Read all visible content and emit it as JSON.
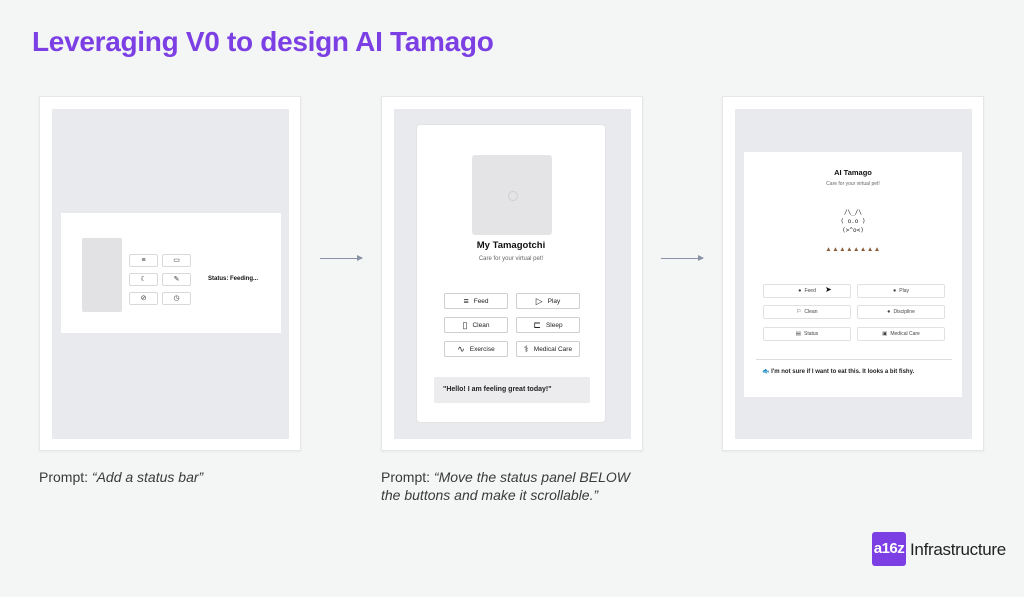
{
  "slide": {
    "title": "Leveraging V0 to design AI Tamago",
    "logo_mark": "a16z",
    "logo_text": "Infrastructure",
    "accent_color": "#7b3fe4"
  },
  "captions": [
    {
      "prefix": "Prompt: ",
      "quote": "“Add a status bar”"
    },
    {
      "prefix": "Prompt: ",
      "quote": "“Move the status panel BELOW the buttons and make it scrollable.”"
    }
  ],
  "panel1": {
    "buttons": [
      {
        "icon": "menu-icon",
        "glyph": "≡"
      },
      {
        "icon": "battery-icon",
        "glyph": "▭"
      },
      {
        "icon": "moon-icon",
        "glyph": "☾"
      },
      {
        "icon": "pencil-icon",
        "glyph": "✎"
      },
      {
        "icon": "pill-icon",
        "glyph": "⊘"
      },
      {
        "icon": "clock-icon",
        "glyph": "◷"
      }
    ],
    "status": "Status: Feeding..."
  },
  "panel2": {
    "pet_name": "My Tamagotchi",
    "subtitle": "Care for your virtual pet!",
    "buttons": [
      {
        "label": "Feed",
        "icon": "menu-icon",
        "glyph": "≡"
      },
      {
        "label": "Play",
        "icon": "play-icon",
        "glyph": "▷"
      },
      {
        "label": "Clean",
        "icon": "trash-icon",
        "glyph": "▯"
      },
      {
        "label": "Sleep",
        "icon": "bed-icon",
        "glyph": "⊏"
      },
      {
        "label": "Exercise",
        "icon": "activity-icon",
        "glyph": "∿"
      },
      {
        "label": "Medical Care",
        "icon": "medical-icon",
        "glyph": "⚕"
      }
    ],
    "status_message": "\"Hello! I am feeling great today!\""
  },
  "panel3": {
    "app_title": "AI Tamago",
    "subtitle": "Care for your virtual pet!",
    "ascii_art": "/\\_/\\\n( o.o )\n(>^o<)",
    "hearts": "▲▲▲▲▲▲▲▲",
    "buttons": [
      {
        "label": "Feed",
        "icon": "food-icon",
        "glyph": "●"
      },
      {
        "label": "Play",
        "icon": "play-icon",
        "glyph": "●"
      },
      {
        "label": "Clean",
        "icon": "clean-icon",
        "glyph": "⚐"
      },
      {
        "label": "Discipline",
        "icon": "discipline-icon",
        "glyph": "●"
      },
      {
        "label": "Status",
        "icon": "chart-icon",
        "glyph": "▤"
      },
      {
        "label": "Medical Care",
        "icon": "medical-icon",
        "glyph": "▣"
      }
    ],
    "status_message": "🐟 I'm not sure if I want to eat this. It looks a bit fishy."
  }
}
